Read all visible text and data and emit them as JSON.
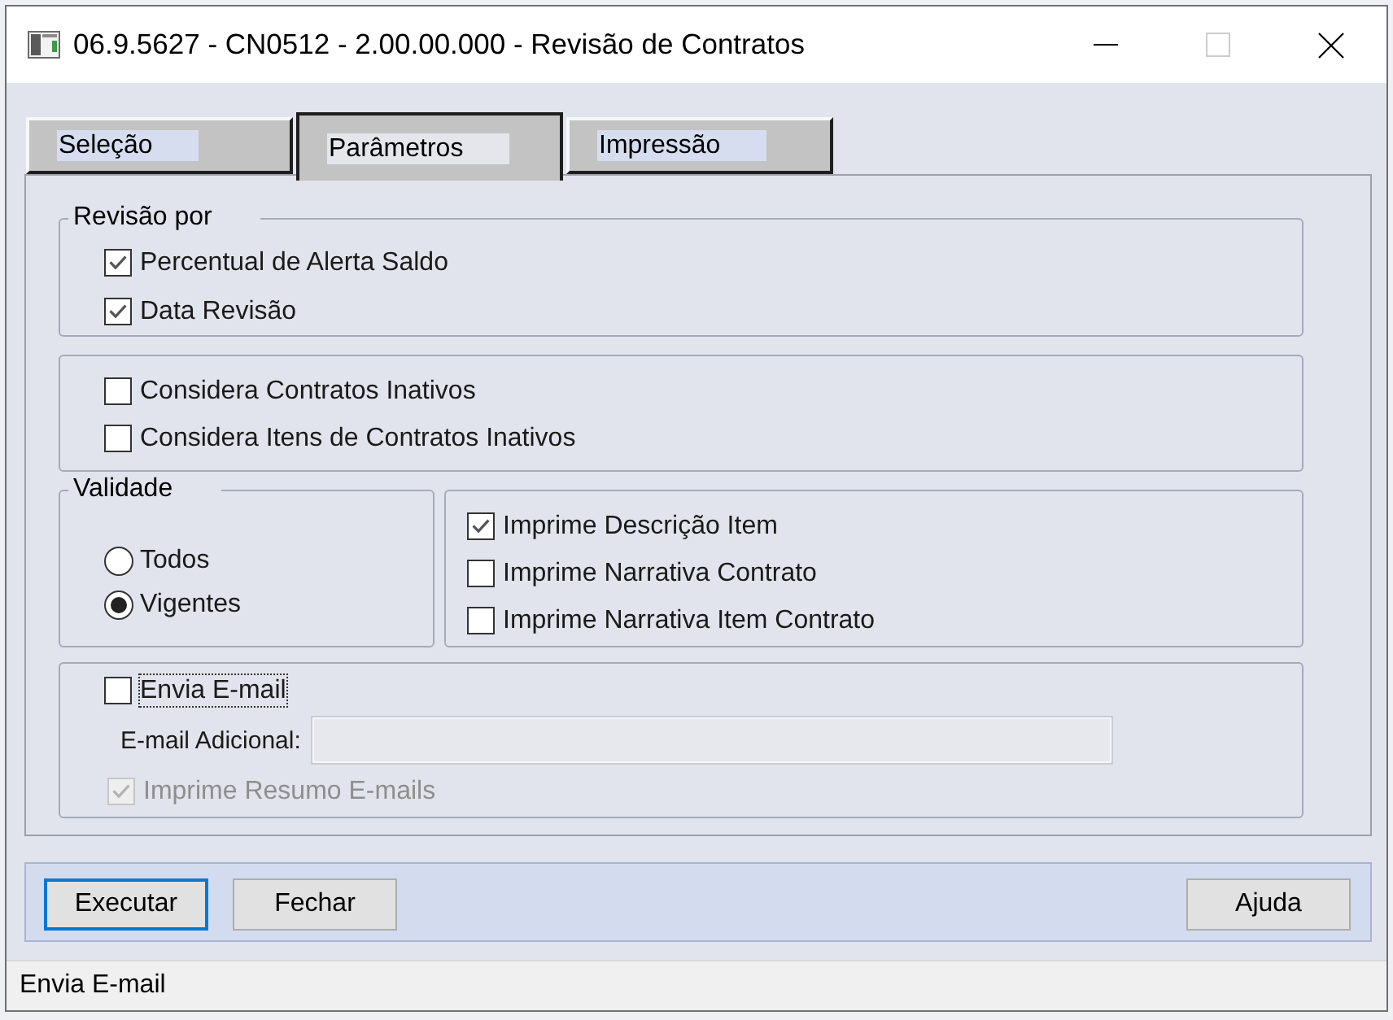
{
  "window": {
    "title": "06.9.5627 - CN0512 - 2.00.00.000 - Revisão de Contratos",
    "maximize_disabled": true
  },
  "tabs": [
    {
      "label": "Seleção",
      "selected": false
    },
    {
      "label": "Parâmetros",
      "selected": true
    },
    {
      "label": "Impressão",
      "selected": false
    }
  ],
  "revisao_por": {
    "legend": "Revisão por",
    "options": [
      {
        "label": "Percentual de Alerta Saldo",
        "checked": true
      },
      {
        "label": "Data Revisão",
        "checked": true
      }
    ]
  },
  "inativos": {
    "options": [
      {
        "label": "Considera Contratos Inativos",
        "checked": false
      },
      {
        "label": "Considera Itens de Contratos Inativos",
        "checked": false
      }
    ]
  },
  "validade": {
    "legend": "Validade",
    "options": [
      {
        "label": "Todos",
        "selected": false
      },
      {
        "label": "Vigentes",
        "selected": true
      }
    ]
  },
  "impressao": {
    "options": [
      {
        "label": "Imprime Descrição Item",
        "checked": true
      },
      {
        "label": "Imprime Narrativa Contrato",
        "checked": false
      },
      {
        "label": "Imprime Narrativa Item Contrato",
        "checked": false
      }
    ]
  },
  "email": {
    "send": {
      "label": "Envia E-mail",
      "checked": false,
      "focused": true
    },
    "additional": {
      "label": "E-mail Adicional:",
      "disabled": true
    },
    "summary": {
      "label": "Imprime Resumo E-mails",
      "checked": true,
      "disabled": true
    }
  },
  "buttons": {
    "left": [
      {
        "label": "Executar",
        "focused": true
      },
      {
        "label": "Fechar",
        "focused": false
      }
    ],
    "right": [
      {
        "label": "Ajuda",
        "focused": false
      }
    ]
  },
  "status_bar": {
    "text": "Envia E-mail"
  }
}
